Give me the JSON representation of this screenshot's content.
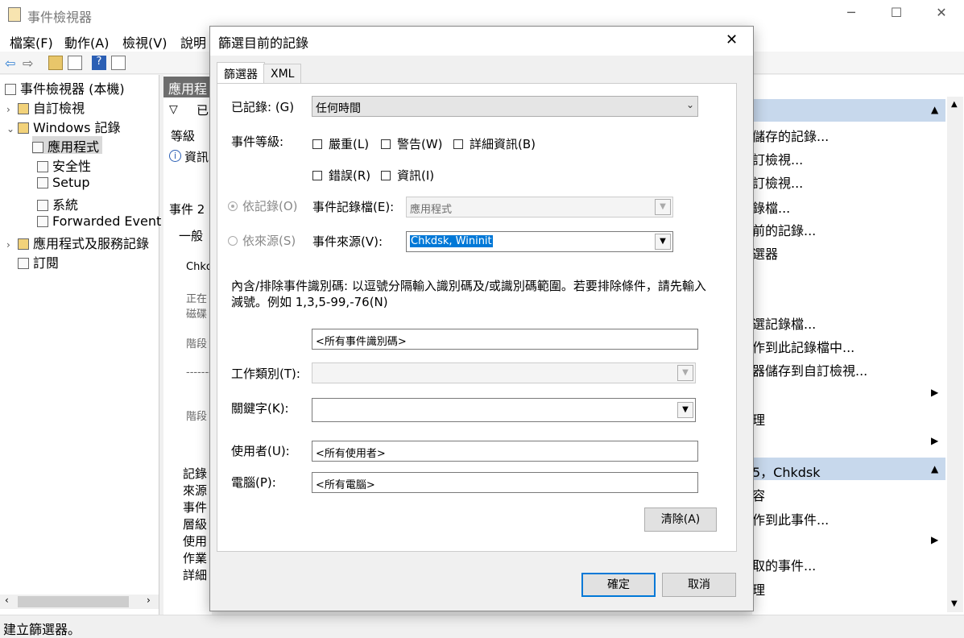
{
  "app": {
    "title": "事件檢視器",
    "status": "建立篩選器。"
  },
  "menu": [
    "檔案(F)",
    "動作(A)",
    "檢視(V)",
    "說明"
  ],
  "tree": {
    "root": "事件檢視器 (本機)",
    "custom_views": "自訂檢視",
    "windows_logs": "Windows 記錄",
    "application": "應用程式",
    "security": "安全性",
    "setup": "Setup",
    "system": "系統",
    "forwarded": "Forwarded Event",
    "app_services": "應用程式及服務記錄",
    "subscriptions": "訂閱"
  },
  "middle": {
    "header": "應用程",
    "filter_label": "已",
    "col_level": "等級",
    "row_info": "資訊",
    "detail_tab": "事件 2",
    "general_tab": "一般",
    "snippets": [
      "Chkd",
      "正在",
      "磁碟",
      "階段",
      "-------",
      "階段"
    ],
    "field_labels": [
      "記錄",
      "來源",
      "事件",
      "層級",
      "使用",
      "作業",
      "詳細"
    ]
  },
  "actions": {
    "items": [
      "儲存的記錄...",
      "訂檢視...",
      "訂檢視...",
      "錄檔...",
      "前的記錄...",
      "選器",
      "選記錄檔...",
      "作到此記錄檔中...",
      "器儲存到自訂檢視...",
      "理",
      "容",
      "作到此事件...",
      "取的事件...",
      "理"
    ],
    "section2": "5，Chkdsk"
  },
  "dialog": {
    "title": "篩選目前的記錄",
    "tabs": [
      "篩選器",
      "XML"
    ],
    "logged_label": "已記錄: (G)",
    "logged_value": "任何時間",
    "level_label": "事件等級:",
    "levels": [
      "嚴重(L)",
      "警告(W)",
      "詳細資訊(B)",
      "錯誤(R)",
      "資訊(I)"
    ],
    "by_log": "依記錄(O)",
    "by_source": "依來源(S)",
    "event_logs_label": "事件記錄檔(E):",
    "event_logs_value": "應用程式",
    "event_sources_label": "事件來源(V):",
    "event_sources_value": "Chkdsk, Wininit",
    "id_description": "內含/排除事件識別碼: 以逗號分隔輸入識別碼及/或識別碼範圍。若要排除條件，請先輸入減號。例如 1,3,5-99,-76(N)",
    "id_value": "<所有事件識別碼>",
    "task_label": "工作類別(T):",
    "keywords_label": "關鍵字(K):",
    "user_label": "使用者(U):",
    "user_value": "<所有使用者>",
    "computer_label": "電腦(P):",
    "computer_value": "<所有電腦>",
    "clear_button": "清除(A)",
    "ok_button": "確定",
    "cancel_button": "取消"
  }
}
